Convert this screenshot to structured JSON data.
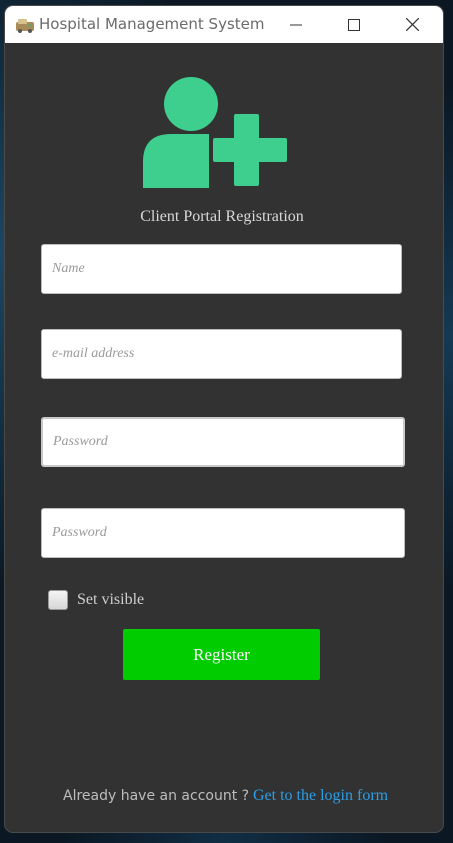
{
  "window": {
    "title": "Hospital Management System"
  },
  "form": {
    "heading": "Client Portal Registration",
    "name_placeholder": "Name",
    "email_placeholder": "e-mail address",
    "password_placeholder": "Password",
    "confirm_password_placeholder": "Password",
    "set_visible_label": "Set visible",
    "set_visible_checked": false,
    "register_label": "Register"
  },
  "footer": {
    "prompt": "Already have an account ?",
    "login_link": "Get to the login form"
  },
  "icons": {
    "app": "hospital-app-icon",
    "user_add": "user-add-icon",
    "minimize": "minimize-icon",
    "maximize": "maximize-icon",
    "close": "close-icon"
  },
  "colors": {
    "background": "#323232",
    "accent_green": "#3ecf8e",
    "register_button": "#00cc00",
    "link": "#2b9ee6"
  }
}
